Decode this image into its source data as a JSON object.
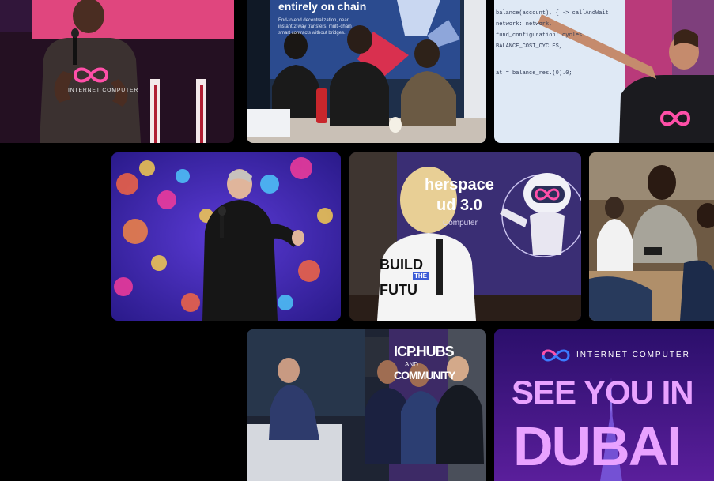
{
  "gallery": {
    "tile_speaker": {
      "shirt_text": "INTERNET COMPUTER"
    },
    "tile_panel": {
      "banner_heading": "entirely on chain",
      "banner_body": "End-to-end decentralization, near instant 2-way transfers, multi-chain smart contracts without bridges."
    },
    "tile_whiteboard": {
      "code_lines": [
        "balance(account), { -> callAndWait",
        "network: network,",
        "fund_configuration: cycles",
        "BALANCE_COST_CYCLES,",
        "at = balance_res.(0).0;"
      ]
    },
    "tile_banner": {
      "line_1": "herspace",
      "line_2": "ud 3.0",
      "line_3": "Computer",
      "shirt_line_1": "BUILD",
      "shirt_line_2": "THE",
      "shirt_line_3": "FUTU"
    },
    "tile_panel2": {
      "banner_line_1": "ICP.HUBS",
      "banner_line_2": "AND",
      "banner_line_3": "COMMUNITY"
    },
    "tile_dubai": {
      "brand": "INTERNET COMPUTER",
      "line_1": "SEE YOU IN",
      "line_2": "DUBAI"
    }
  },
  "colors": {
    "background": "#000000",
    "dubai_bg": "#2b0f6b",
    "dubai_text": "#e9a2ff",
    "logo_pink": "#ff4fa8",
    "logo_blue": "#3b7bff"
  }
}
